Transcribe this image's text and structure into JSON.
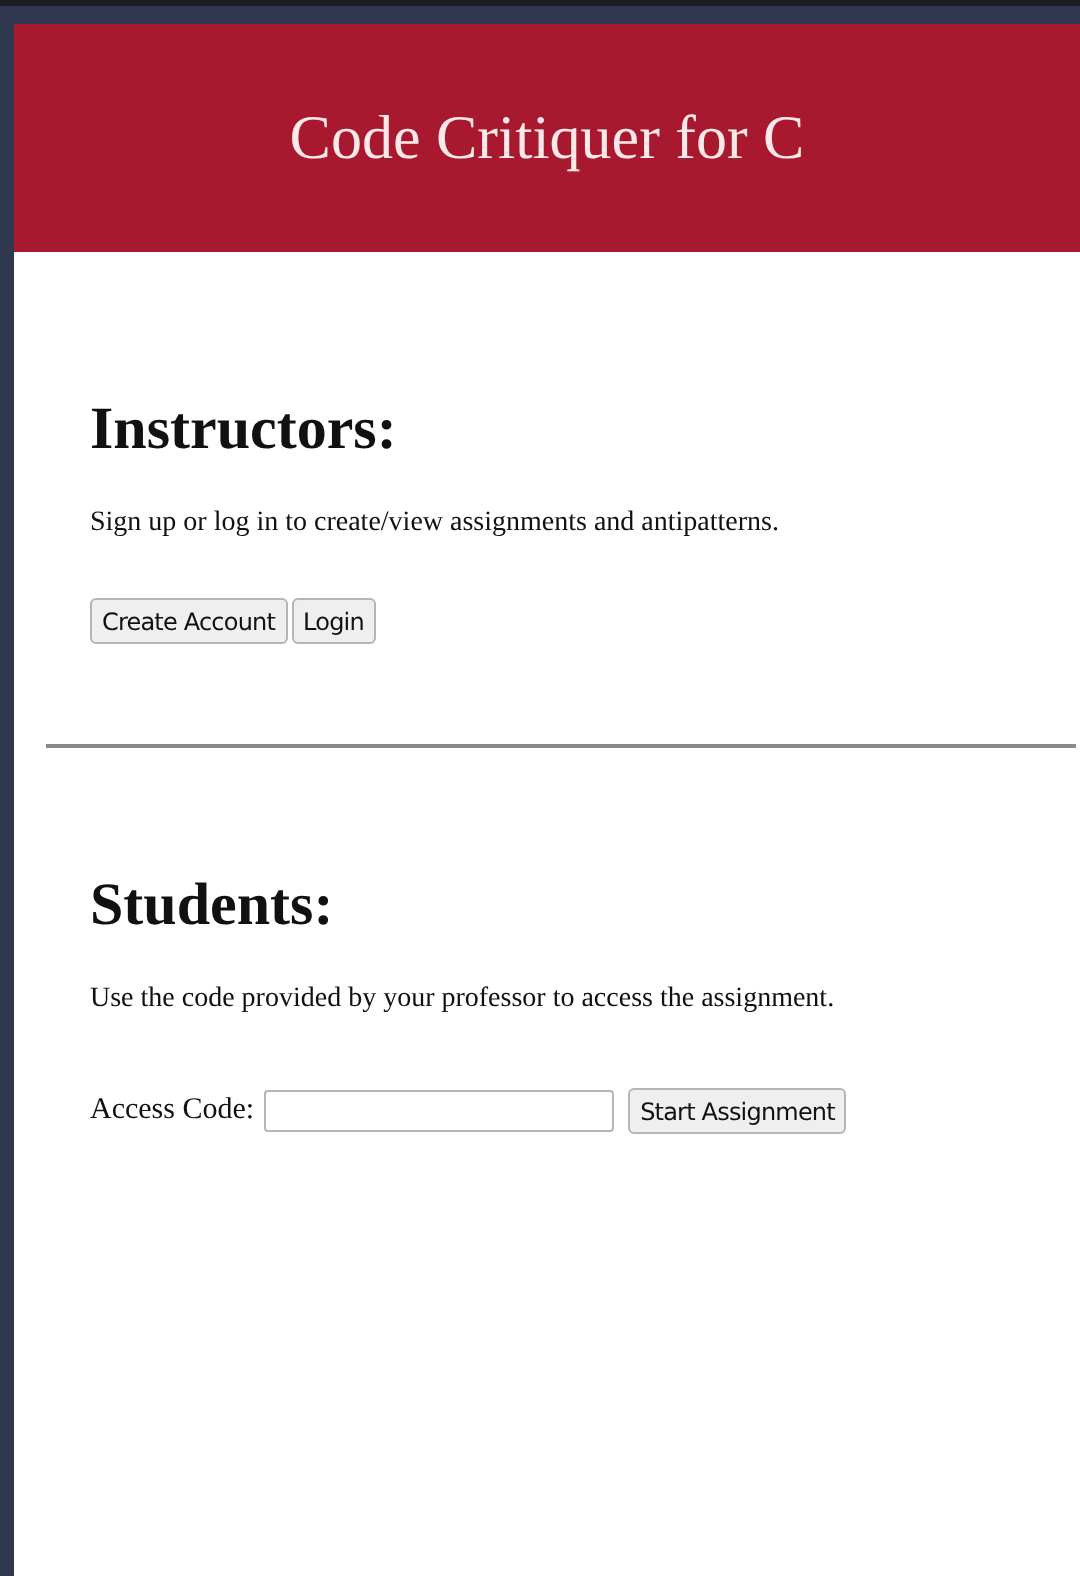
{
  "header": {
    "title": "Code Critiquer for C"
  },
  "instructors": {
    "heading": "Instructors:",
    "text": "Sign up or log in to create/view assignments and antipatterns.",
    "buttons": [
      "Create Account",
      "Login"
    ]
  },
  "students": {
    "heading": "Students:",
    "text": "Use the code provided by your professor to access the assignment.",
    "field_label": "Access Code:",
    "button": "Start Assignment"
  }
}
